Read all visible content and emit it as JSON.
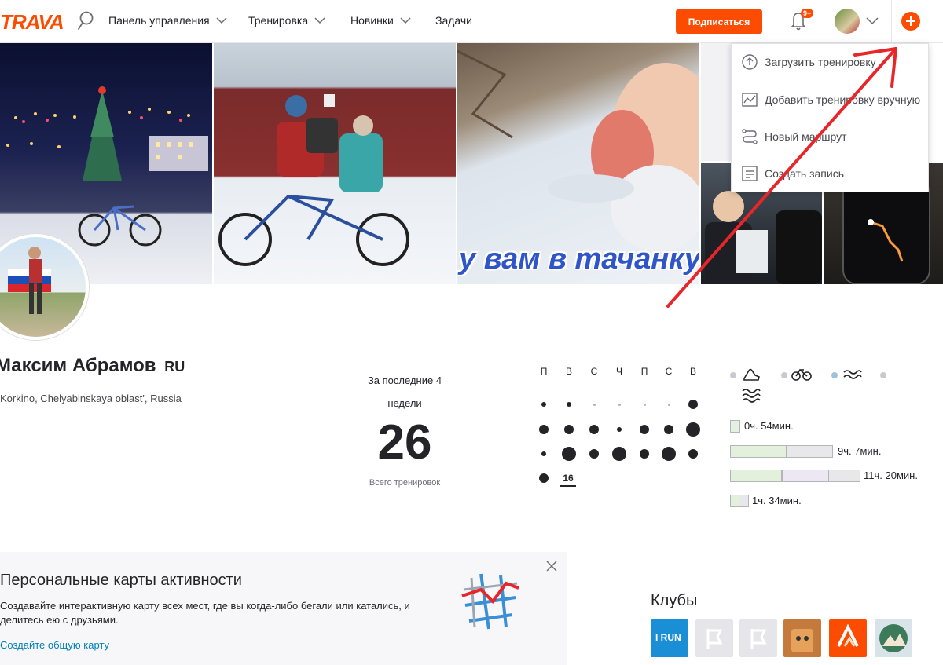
{
  "nav": {
    "logo": "TRAVA",
    "items": [
      {
        "label": "Панель управления",
        "has_menu": true
      },
      {
        "label": "Тренировка",
        "has_menu": true
      },
      {
        "label": "Новинки",
        "has_menu": true
      },
      {
        "label": "Задачи",
        "has_menu": false
      }
    ],
    "subscribe_label": "Подписаться",
    "notifications_badge": "9+",
    "accent_color": "#fc4c02"
  },
  "photos": {
    "caption": "у вам в тачанку"
  },
  "add_menu": {
    "items": [
      {
        "label": "Загрузить тренировку",
        "icon": "upload-icon"
      },
      {
        "label": "Добавить тренировку вручную",
        "icon": "manual-entry-icon"
      },
      {
        "label": "Новый маршрут",
        "icon": "route-icon"
      },
      {
        "label": "Создать запись",
        "icon": "post-icon"
      }
    ]
  },
  "profile": {
    "name": "Максим Абрамов",
    "country_code": "RU",
    "location": "Korkino, Chelyabinskaya oblast', Russia"
  },
  "stats": {
    "period_label": "За последние 4 недели",
    "total_workouts": "26",
    "total_label": "Всего тренировок"
  },
  "calendar": {
    "days": [
      "П",
      "В",
      "С",
      "Ч",
      "П",
      "С",
      "В"
    ],
    "today_date": "16",
    "weeks": [
      [
        1,
        1,
        0,
        0,
        0,
        0,
        2
      ],
      [
        2,
        2,
        2,
        1,
        2,
        2,
        3
      ],
      [
        1,
        3,
        2,
        3,
        2,
        3,
        2
      ],
      [
        2,
        0,
        0,
        0,
        0,
        0,
        0
      ]
    ]
  },
  "sports": {
    "icons": [
      "run-icon",
      "bike-icon",
      "swim-icon",
      "other-sport-icon"
    ],
    "bars": [
      {
        "label": "0ч. 54мин.",
        "fraction": 0.1
      },
      {
        "label": "9ч. 7мин.",
        "fraction": 0.55
      },
      {
        "label": "11ч. 20мин.",
        "fraction": 0.4
      },
      {
        "label": "1ч. 34мин.",
        "fraction": 0.5
      }
    ]
  },
  "promo": {
    "title": "Персональные карты активности",
    "text": "Создавайте интерактивную карту всех мест, где вы когда-либо бегали или катались, и делитесь ею с друзьями.",
    "link": "Создайте общую карту"
  },
  "clubs": {
    "title": "Клубы",
    "items": [
      {
        "name": "I RUN",
        "color": "#1b8fd6"
      },
      {
        "name": "",
        "color": "#e6e6ea"
      },
      {
        "name": "",
        "color": "#e6e6ea"
      },
      {
        "name": "",
        "color": "#c47a3c"
      },
      {
        "name": "",
        "color": "#fc4c02"
      },
      {
        "name": "",
        "color": "#d8e4ea"
      }
    ]
  }
}
